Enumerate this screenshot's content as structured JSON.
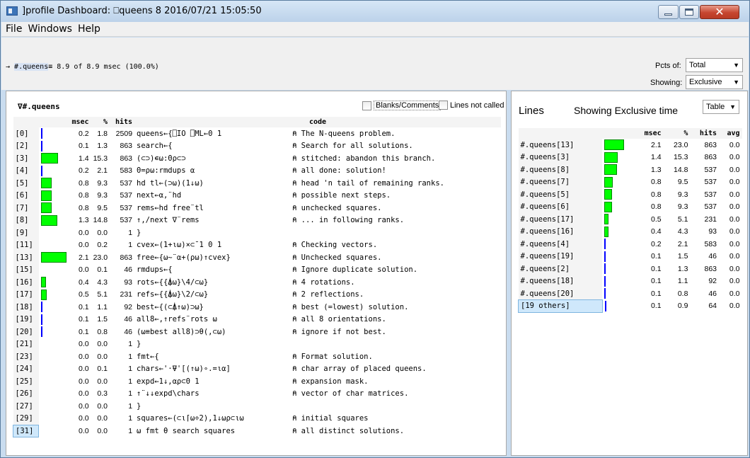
{
  "window": {
    "title": "]profile Dashboard: ⎕queens 8 2016/07/21 15:05:50"
  },
  "menu": [
    "File",
    "Windows",
    "Help"
  ],
  "summary": {
    "prefix": "→ ",
    "fn": "#.queens",
    "eq": "≡",
    "text": " 8.9 of 8.9 msec (100.0%)"
  },
  "controls": {
    "pcts_label": "Pcts of:",
    "pcts_value": "Total",
    "showing_label": "Showing:",
    "showing_value": "Exclusive",
    "table_value": "Table"
  },
  "left": {
    "title": "∇#.queens",
    "blanks_label": "Blanks/Comments",
    "notcalled_label": "Lines not called",
    "headers": {
      "msec": "msec",
      "pct": "%",
      "hits": "hits",
      "code": "code"
    },
    "rows": [
      {
        "line": "[0]",
        "msec": "0.2",
        "pct": "1.8",
        "hits": "2509",
        "code": "queens←{⎕IO ⎕ML←0 1",
        "comment": "⍝ The N-queens problem."
      },
      {
        "line": "[2]",
        "msec": "0.1",
        "pct": "1.3",
        "hits": "863",
        "code": "      search←{",
        "comment": "⍝ Search for all solutions."
      },
      {
        "line": "[3]",
        "msec": "1.4",
        "pct": "15.3",
        "hits": "863",
        "code": "          (⊂⊃)∊⍵:0ρ⊂⊃",
        "comment": "⍝ stitched: abandon this branch."
      },
      {
        "line": "[4]",
        "msec": "0.2",
        "pct": "2.1",
        "hits": "583",
        "code": "          0=ρ⍵:rmdups ⍺",
        "comment": "⍝ all done: solution!"
      },
      {
        "line": "[5]",
        "msec": "0.8",
        "pct": "9.3",
        "hits": "537",
        "code": "          hd tl←(⊃⍵)(1↓⍵)",
        "comment": "⍝ head 'n tail of remaining ranks."
      },
      {
        "line": "[6]",
        "msec": "0.8",
        "pct": "9.3",
        "hits": "537",
        "code": "          next←⍺,¨hd",
        "comment": "⍝ possible next steps."
      },
      {
        "line": "[7]",
        "msec": "0.8",
        "pct": "9.5",
        "hits": "537",
        "code": "          rems←hd free¨tl",
        "comment": "⍝ unchecked squares."
      },
      {
        "line": "[8]",
        "msec": "1.3",
        "pct": "14.8",
        "hits": "537",
        "code": "          ↑,/next ∇¨rems",
        "comment": "⍝ ... in following ranks."
      },
      {
        "line": "[9]",
        "msec": "0.0",
        "pct": "0.0",
        "hits": "1",
        "code": "      }",
        "comment": ""
      },
      {
        "line": "[11]",
        "msec": "0.0",
        "pct": "0.2",
        "hits": "1",
        "code": "      cvex←(1+ι⍵)×⊂¯1 0 1",
        "comment": "⍝ Checking vectors."
      },
      {
        "line": "[13]",
        "msec": "2.1",
        "pct": "23.0",
        "hits": "863",
        "code": "      free←{⍵~¨⍺+(ρ⍵)↑cvex}",
        "comment": "⍝ Unchecked squares."
      },
      {
        "line": "[15]",
        "msec": "0.0",
        "pct": "0.1",
        "hits": "46",
        "code": "      rmdups←{",
        "comment": "⍝ Ignore duplicate solution."
      },
      {
        "line": "[16]",
        "msec": "0.4",
        "pct": "4.3",
        "hits": "93",
        "code": "          rots←{{⍋⍵}\\4/⊂⍵}",
        "comment": "⍝ 4 rotations."
      },
      {
        "line": "[17]",
        "msec": "0.5",
        "pct": "5.1",
        "hits": "231",
        "code": "          refs←{{⍋⍵}\\2/⊂⍵}",
        "comment": "⍝ 2 reflections."
      },
      {
        "line": "[18]",
        "msec": "0.1",
        "pct": "1.1",
        "hits": "92",
        "code": "          best←{(⊂⍋↑⍵)⊃⍵}",
        "comment": "⍝ best (=lowest) solution."
      },
      {
        "line": "[19]",
        "msec": "0.1",
        "pct": "1.5",
        "hits": "46",
        "code": "          all8←,↑refs¨rots ⍵",
        "comment": "⍝ all 8 orientations."
      },
      {
        "line": "[20]",
        "msec": "0.1",
        "pct": "0.8",
        "hits": "46",
        "code": "          (⍵≡best all8)⊃θ(,⊂⍵)",
        "comment": "⍝ ignore if not best."
      },
      {
        "line": "[21]",
        "msec": "0.0",
        "pct": "0.0",
        "hits": "1",
        "code": "      }",
        "comment": ""
      },
      {
        "line": "[23]",
        "msec": "0.0",
        "pct": "0.0",
        "hits": "1",
        "code": "      fmt←{",
        "comment": "⍝ Format solution."
      },
      {
        "line": "[24]",
        "msec": "0.0",
        "pct": "0.1",
        "hits": "1",
        "code": "          chars←'·⍫'[(↑⍵)∘.=ι⍺]",
        "comment": "⍝ char array of placed queens."
      },
      {
        "line": "[25]",
        "msec": "0.0",
        "pct": "0.0",
        "hits": "1",
        "code": "          expd←1↓,⍺ρ⊂0 1",
        "comment": "⍝ expansion mask."
      },
      {
        "line": "[26]",
        "msec": "0.0",
        "pct": "0.3",
        "hits": "1",
        "code": "          ↑¨↓↓expd\\chars",
        "comment": "⍝ vector of char matrices."
      },
      {
        "line": "[27]",
        "msec": "0.0",
        "pct": "0.0",
        "hits": "1",
        "code": "      }",
        "comment": ""
      },
      {
        "line": "[29]",
        "msec": "0.0",
        "pct": "0.0",
        "hits": "1",
        "code": "      squares←(⊂ι⌈⍵÷2),1↓⍵ρ⊂ι⍵",
        "comment": "⍝ initial squares"
      },
      {
        "line": "[31]",
        "msec": "0.0",
        "pct": "0.0",
        "hits": "1",
        "code": "      ⍵ fmt θ search squares",
        "comment": "⍝ all distinct solutions."
      }
    ]
  },
  "right": {
    "title": "Lines",
    "subtitle": "Showing Exclusive time",
    "headers": {
      "msec": "msec",
      "pct": "%",
      "hits": "hits",
      "avg": "avg"
    },
    "rows": [
      {
        "name": "#.queens[13]",
        "msec": "2.1",
        "pct": "23.0",
        "hits": "863",
        "avg": "0.0"
      },
      {
        "name": "#.queens[3]",
        "msec": "1.4",
        "pct": "15.3",
        "hits": "863",
        "avg": "0.0"
      },
      {
        "name": "#.queens[8]",
        "msec": "1.3",
        "pct": "14.8",
        "hits": "537",
        "avg": "0.0"
      },
      {
        "name": "#.queens[7]",
        "msec": "0.8",
        "pct": "9.5",
        "hits": "537",
        "avg": "0.0"
      },
      {
        "name": "#.queens[5]",
        "msec": "0.8",
        "pct": "9.3",
        "hits": "537",
        "avg": "0.0"
      },
      {
        "name": "#.queens[6]",
        "msec": "0.8",
        "pct": "9.3",
        "hits": "537",
        "avg": "0.0"
      },
      {
        "name": "#.queens[17]",
        "msec": "0.5",
        "pct": "5.1",
        "hits": "231",
        "avg": "0.0"
      },
      {
        "name": "#.queens[16]",
        "msec": "0.4",
        "pct": "4.3",
        "hits": "93",
        "avg": "0.0"
      },
      {
        "name": "#.queens[4]",
        "msec": "0.2",
        "pct": "2.1",
        "hits": "583",
        "avg": "0.0"
      },
      {
        "name": "#.queens[19]",
        "msec": "0.1",
        "pct": "1.5",
        "hits": "46",
        "avg": "0.0"
      },
      {
        "name": "#.queens[2]",
        "msec": "0.1",
        "pct": "1.3",
        "hits": "863",
        "avg": "0.0"
      },
      {
        "name": "#.queens[18]",
        "msec": "0.1",
        "pct": "1.1",
        "hits": "92",
        "avg": "0.0"
      },
      {
        "name": "#.queens[20]",
        "msec": "0.1",
        "pct": "0.8",
        "hits": "46",
        "avg": "0.0"
      },
      {
        "name": "[19 others]",
        "msec": "0.1",
        "pct": "0.9",
        "hits": "64",
        "avg": "0.0"
      }
    ]
  },
  "colors": {
    "bar": "#00ff00",
    "thin_bar": "#0000ff",
    "selected": "#cfe8fb"
  }
}
